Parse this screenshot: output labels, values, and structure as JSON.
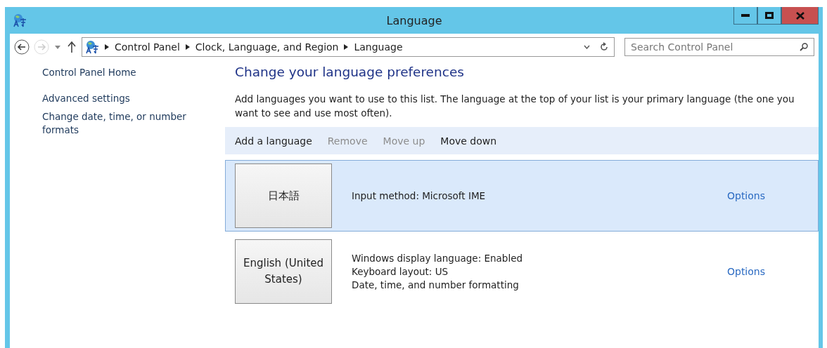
{
  "window": {
    "title": "Language"
  },
  "address_bar": {
    "crumbs": [
      "Control Panel",
      "Clock, Language, and Region",
      "Language"
    ]
  },
  "search": {
    "placeholder": "Search Control Panel"
  },
  "sidebar": {
    "items": [
      {
        "label": "Control Panel Home"
      },
      {
        "label": "Advanced settings"
      },
      {
        "label": "Change date, time, or number formats"
      }
    ]
  },
  "heading": "Change your language preferences",
  "description": "Add languages you want to use to this list. The language at the top of your list is your primary language (the one you want to see and use most often).",
  "toolbar": [
    {
      "label": "Add a language",
      "disabled": false
    },
    {
      "label": "Remove",
      "disabled": true
    },
    {
      "label": "Move up",
      "disabled": true
    },
    {
      "label": "Move down",
      "disabled": false
    }
  ],
  "languages": [
    {
      "name": "日本語",
      "selected": true,
      "details": [
        "Input method: Microsoft IME"
      ],
      "options": "Options"
    },
    {
      "name": "English (United States)",
      "selected": false,
      "details": [
        "Windows display language: Enabled",
        "Keyboard layout: US",
        "Date, time, and number formatting"
      ],
      "options": "Options"
    }
  ]
}
